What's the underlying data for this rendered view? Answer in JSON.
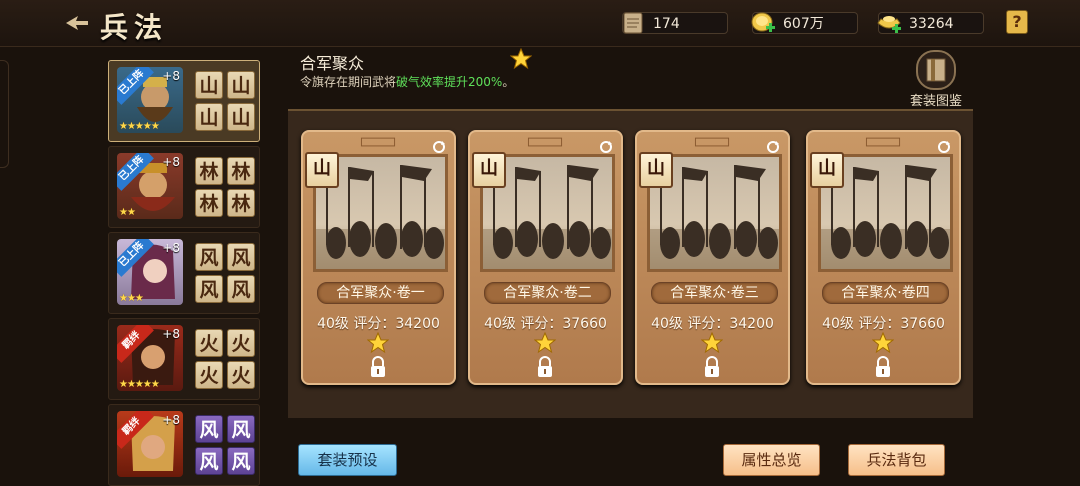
{
  "header": {
    "title": "兵法",
    "scrolls": "174",
    "gold": "607万",
    "ingots": "33264",
    "help": "?"
  },
  "sidebar": {
    "heroes": [
      {
        "ribbon": "已上阵",
        "level": "+8",
        "stars": "★★★★★",
        "tile": "山",
        "tile_style": "brown",
        "selected": true
      },
      {
        "ribbon": "已上阵",
        "level": "+8",
        "stars": "★★",
        "tile": "林",
        "tile_style": "brown",
        "selected": false
      },
      {
        "ribbon": "已上阵",
        "level": "+8",
        "stars": "★★★",
        "tile": "风",
        "tile_style": "brown",
        "selected": false
      },
      {
        "ribbon": "羁绊",
        "level": "+8",
        "stars": "★★★★★",
        "tile": "火",
        "tile_style": "brown",
        "selected": false
      },
      {
        "ribbon": "羁绊",
        "level": "+8",
        "stars": "",
        "tile": "风",
        "tile_style": "purple",
        "selected": false
      }
    ]
  },
  "set": {
    "name": "合军聚众",
    "desc_prefix": "令旗存在期间武将",
    "desc_highlight": "破气效率提升200%",
    "desc_suffix": "。",
    "gallery_label": "套装图鉴"
  },
  "cards": [
    {
      "badge": "山",
      "name": "合军聚众·卷一",
      "stats": "40级  评分：34200"
    },
    {
      "badge": "山",
      "name": "合军聚众·卷二",
      "stats": "40级  评分：37660"
    },
    {
      "badge": "山",
      "name": "合军聚众·卷三",
      "stats": "40级  评分：34200"
    },
    {
      "badge": "山",
      "name": "合军聚众·卷四",
      "stats": "40级  评分：37660"
    }
  ],
  "buttons": {
    "preset": "套装预设",
    "overview": "属性总览",
    "bag": "兵法背包"
  },
  "colors": {
    "accent": "#e6b84a",
    "highlight": "#5fe05a",
    "preset_button": "#66b8e8",
    "action_button": "#f6bf8a"
  }
}
